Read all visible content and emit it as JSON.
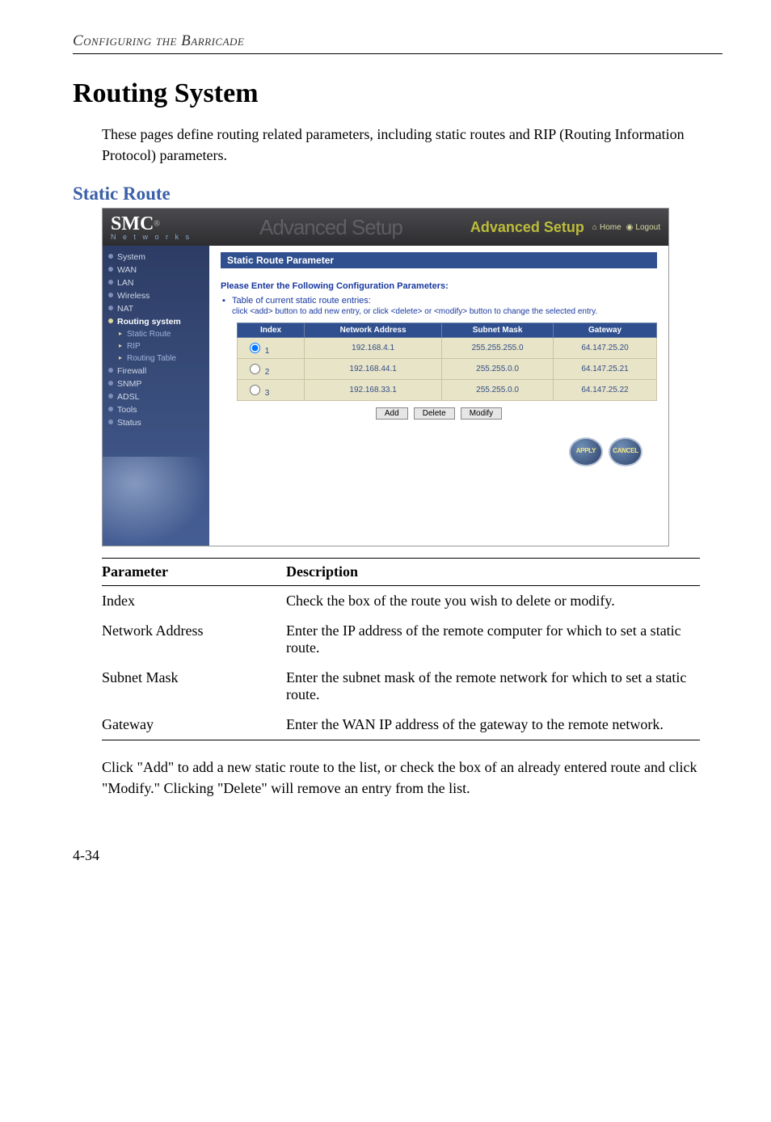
{
  "doc": {
    "header": "Configuring the Barricade",
    "main_heading": "Routing System",
    "intro": "These pages define routing related parameters, including static routes and RIP (Routing Information Protocol) parameters.",
    "sub_heading": "Static Route",
    "closing": "Click \"Add\" to add a new static route to the list, or check the box of an already entered route and click \"Modify.\" Clicking \"Delete\" will remove an entry from the list.",
    "page_number": "4-34"
  },
  "screenshot": {
    "logo": "SMC",
    "logo_sub": "N e t w o r k s",
    "adv_ghost": "Advanced Setup",
    "adv_setup": "Advanced Setup",
    "home": "Home",
    "logout": "Logout",
    "sidebar": [
      "System",
      "WAN",
      "LAN",
      "Wireless",
      "NAT",
      "Routing system",
      "Static Route",
      "RIP",
      "Routing Table",
      "Firewall",
      "SNMP",
      "ADSL",
      "Tools",
      "Status"
    ],
    "panel_title": "Static Route Parameter",
    "conf_label": "Please Enter the Following Configuration Parameters:",
    "bullet": "Table of current static route entries:",
    "hint": "click <add> button to add new entry, or click <delete> or <modify> button to change the selected entry.",
    "table": {
      "headers": [
        "Index",
        "Network Address",
        "Subnet Mask",
        "Gateway"
      ],
      "rows": [
        {
          "index": "1",
          "net": "192.168.4.1",
          "mask": "255.255.255.0",
          "gw": "64.147.25.20",
          "checked": true
        },
        {
          "index": "2",
          "net": "192.168.44.1",
          "mask": "255.255.0.0",
          "gw": "64.147.25.21",
          "checked": false
        },
        {
          "index": "3",
          "net": "192.168.33.1",
          "mask": "255.255.0.0",
          "gw": "64.147.25.22",
          "checked": false
        }
      ]
    },
    "buttons": {
      "add": "Add",
      "delete": "Delete",
      "modify": "Modify",
      "apply": "APPLY",
      "cancel": "CANCEL"
    }
  },
  "param_table": {
    "head": {
      "param": "Parameter",
      "desc": "Description"
    },
    "rows": [
      {
        "param": "Index",
        "desc": "Check the box of the route you wish to delete or modify."
      },
      {
        "param": "Network Address",
        "desc": "Enter the IP address of the remote computer for which to set a static route."
      },
      {
        "param": "Subnet Mask",
        "desc": "Enter the subnet mask of the remote network for which to set a static route."
      },
      {
        "param": "Gateway",
        "desc": "Enter the WAN IP address of the gateway to the remote network."
      }
    ]
  }
}
